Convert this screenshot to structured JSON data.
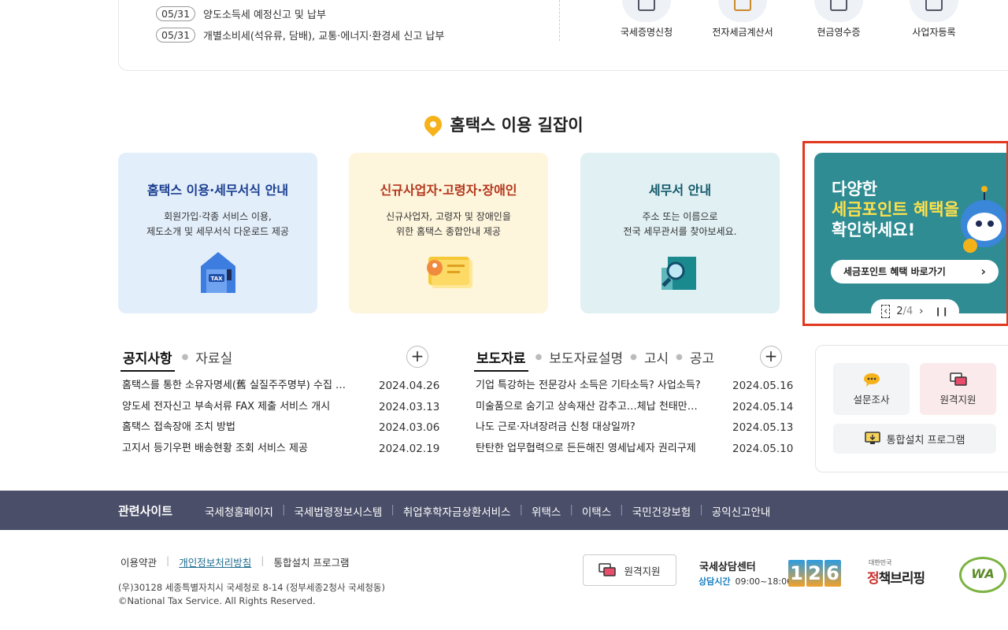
{
  "schedule": [
    {
      "date": "05/31",
      "text": "양도소득세 예정신고 및 납부"
    },
    {
      "date": "05/31",
      "text": "개별소비세(석유류, 담배), 교통·에너지·환경세 신고 납부"
    }
  ],
  "services": [
    {
      "label": "국세증명신청",
      "icon": "certificate-icon"
    },
    {
      "label": "전자세금계산서",
      "icon": "tax-invoice-icon"
    },
    {
      "label": "현금영수증",
      "icon": "cash-receipt-icon"
    },
    {
      "label": "사업자등록",
      "icon": "business-register-icon"
    }
  ],
  "guide": {
    "title": "홈택스 이용 길잡이",
    "cards": [
      {
        "title": "홈택스 이용·세무서식 안내",
        "line1": "회원가입·각종 서비스 이용,",
        "line2": "제도소개 및 세무서식 다운로드 제공",
        "icon": "tax-house-icon",
        "color": "#1b3f8f"
      },
      {
        "title": "신규사업자·고령자·장애인",
        "line1": "신규사업자, 고령자 및 장애인을",
        "line2": "위한 홈택스 종합안내 제공",
        "icon": "id-card-icon",
        "color": "#b3361b"
      },
      {
        "title": "세무서 안내",
        "line1": "주소 또는 이름으로",
        "line2": "전국 세무관서를 찾아보세요.",
        "icon": "building-search-icon",
        "color": "#14596a"
      }
    ]
  },
  "banner": {
    "line1": "다양한",
    "line2": "세금포인트 혜택을",
    "line3": "확인하세요!",
    "button_label": "세금포인트 혜택 바로가기",
    "page_current": "2",
    "page_total": "/4",
    "color": "#2f8c93"
  },
  "notice_board": {
    "tabs": [
      "공지사항",
      "자료실"
    ],
    "items": [
      {
        "title": "홈택스를 통한 소유자명세(舊 실질주주명부) 수집 …",
        "date": "2024.04.26"
      },
      {
        "title": "양도세 전자신고 부속서류 FAX 제출 서비스 개시",
        "date": "2024.03.13"
      },
      {
        "title": "홈택스 접속장애 조치 방법",
        "date": "2024.03.06"
      },
      {
        "title": "고지서 등기우편 배송현황 조회 서비스 제공",
        "date": "2024.02.19"
      }
    ]
  },
  "press_board": {
    "tabs": [
      "보도자료",
      "보도자료설명",
      "고시",
      "공고"
    ],
    "items": [
      {
        "title": "기업 특강하는 전문강사 소득은 기타소득? 사업소득?",
        "date": "2024.05.16"
      },
      {
        "title": "미술품으로 숨기고 상속재산 감추고…체납 천태만…",
        "date": "2024.05.14"
      },
      {
        "title": "나도 근로·자녀장려금 신청 대상일까?",
        "date": "2024.05.13"
      },
      {
        "title": "탄탄한 업무협력으로 든든해진 영세납세자 권리구제",
        "date": "2024.05.10"
      }
    ]
  },
  "quick": {
    "survey": "설문조사",
    "remote": "원격지원",
    "install": "통합설치 프로그램"
  },
  "related": {
    "title": "관련사이트",
    "links": [
      "국세청홈페이지",
      "국세법령정보시스템",
      "취업후학자금상환서비스",
      "위택스",
      "이택스",
      "국민건강보험",
      "공익신고안내"
    ]
  },
  "footer": {
    "terms": "이용약관",
    "privacy": "개인정보처리방침",
    "install": "통합설치 프로그램",
    "address": "(우)30128 세종특별자치시 국세청로 8-14 (정부세종2청사 국세청동)",
    "copyright": "©National Tax Service. All Rights Reserved.",
    "remote_button": "원격지원",
    "center_title": "국세상담센터",
    "center_hours_label": "상담시간",
    "center_hours": "09:00~18:00",
    "center_number": [
      "1",
      "2",
      "6"
    ],
    "briefing_small": "대한민국",
    "briefing_a": "정",
    "briefing_b": "책브리핑",
    "wa_mark": "WA"
  }
}
